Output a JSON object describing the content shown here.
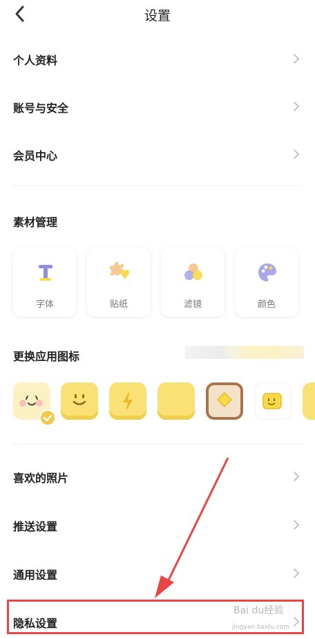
{
  "header": {
    "title": "设置"
  },
  "account_rows": [
    {
      "label": "个人资料"
    },
    {
      "label": "账号与安全"
    },
    {
      "label": "会员中心"
    }
  ],
  "materials": {
    "title": "素材管理",
    "items": [
      {
        "label": "字体",
        "icon": "font-icon"
      },
      {
        "label": "贴纸",
        "icon": "sticker-icon"
      },
      {
        "label": "滤镜",
        "icon": "filter-icon"
      },
      {
        "label": "颜色",
        "icon": "palette-icon"
      }
    ]
  },
  "app_icon": {
    "title": "更换应用图标",
    "options": [
      "smiley-blush",
      "smiley-yellow",
      "lightning-yellow",
      "plain-yellow",
      "toast-diamond",
      "mini-smiley"
    ],
    "selected_index": 0
  },
  "settings_rows": [
    {
      "label": "喜欢的照片"
    },
    {
      "label": "推送设置"
    },
    {
      "label": "通用设置"
    },
    {
      "label": "隐私设置"
    }
  ],
  "watermark": {
    "text": "Bai du经验",
    "subtext": "jingyan.baidu.com"
  },
  "colors": {
    "accent_yellow": "#f8d94a",
    "highlight_red": "#e94545",
    "font_icon_purple": "#8f8fe0"
  }
}
